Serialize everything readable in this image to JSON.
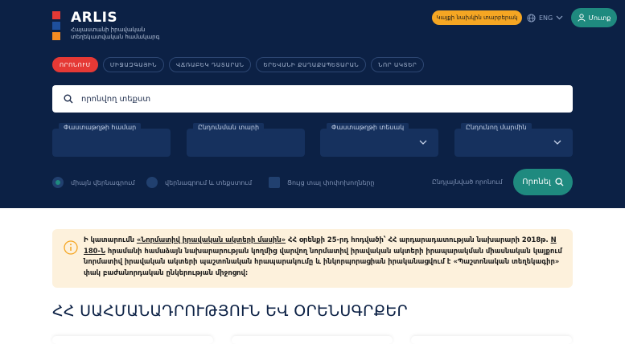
{
  "header": {
    "logo_title": "ARLIS",
    "logo_subtitle": "Հայաստանի իրավական տեղեկատվական համակարգ",
    "old_version_label": "Կայքի նախկին տարբերակ",
    "language_label": "ENG",
    "login_label": "Մուտք"
  },
  "tabs": [
    {
      "label": "ՈՐՈՆՈՒՄ",
      "active": true
    },
    {
      "label": "ՄԻՋԱԶԳԱՅԻՆ"
    },
    {
      "label": "ՎՃՌԱԲԵԿ ԴԱՏԱՐԱՆ"
    },
    {
      "label": "ԵՐԵՎԱՆԻ ՔԱՂԱՔԱՊԵՏԱՐԱՆ"
    },
    {
      "label": "ՆՈՐ ԱԿՏԵՐ"
    }
  ],
  "search": {
    "placeholder": "որոնվող տեքստ"
  },
  "filters": [
    {
      "label": "Փաստաթղթի համար",
      "has_dropdown": false
    },
    {
      "label": "Ընդունման տարի",
      "has_dropdown": false
    },
    {
      "label": "Փաստաթղթի տեսակ",
      "has_dropdown": true
    },
    {
      "label": "Ընդունող մարմին",
      "has_dropdown": true
    }
  ],
  "options": {
    "title_only": "միայն վերնագրում",
    "title_and_text": "վերնագրում և տեքստում",
    "show_changes": "Ցույց տալ փոփոխողները",
    "advanced_search": "Ընդլայնված որոնում",
    "search_button": "Որոնել"
  },
  "notice": {
    "part1": "Ի կատարումն ",
    "link1": "«Նորմատիվ իրավական ակտերի մասին»",
    "part2": " ՀՀ օրենքի 25-րդ հոդվածի՝ ՀՀ արդարադատության նախարարի 2018թ. ",
    "link2": "N 180-Ն",
    "part3": " հրամանի համաձայն նախարարության կողմից վարվող նորմատիվ իրավական ակտերի իրապարակման միասնական կայքում նորմատիվ իրավական ակտերի պաշտոնական հրապարակումը և ինկորպորացիան իրականացվում է «Պաշտոնական տեղեկագիր» փակ բաժանորդական ընկերության միջոցով:"
  },
  "section_title": "ՀՀ ՍԱՀՄԱՆԱԴՐՈՒԹՅՈՒՆ ԵՎ ՕՐԵՆՍԳՐՔԵՐ",
  "colors": {
    "hero_bg": "#0c2145",
    "accent_red": "#e53935",
    "accent_orange": "#f5a623",
    "accent_teal": "#1f8a7f",
    "notice_bg": "#fdf1dc"
  }
}
